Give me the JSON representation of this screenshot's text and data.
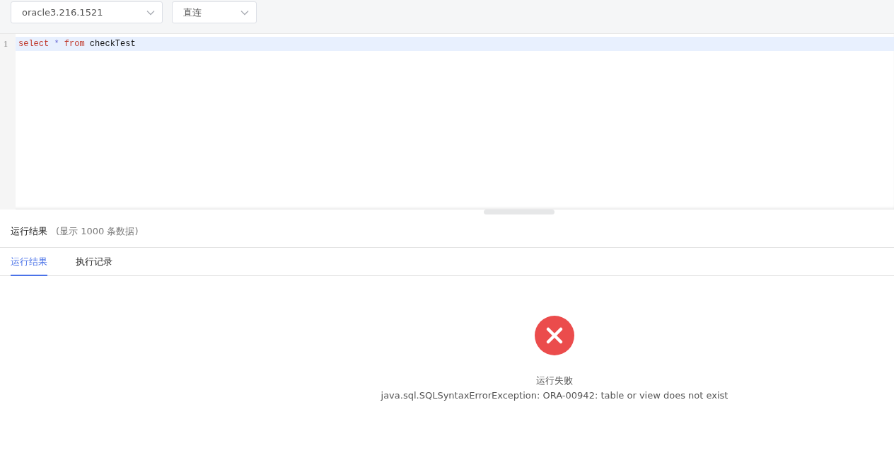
{
  "toolbar": {
    "selects": [
      {
        "value": "oracle3.216.1521"
      },
      {
        "value": "直连"
      }
    ]
  },
  "editor": {
    "lines": [
      {
        "number": "1",
        "active": true,
        "tokens": [
          {
            "kind": "keyword",
            "text": "select"
          },
          {
            "kind": "operator",
            "text": "*"
          },
          {
            "kind": "keyword",
            "text": "from"
          },
          {
            "kind": "identifier",
            "text": "checkTest"
          }
        ]
      }
    ]
  },
  "results": {
    "title": "运行结果",
    "subtitle": "(显示 1000 条数据)",
    "tabs": [
      {
        "label": "运行结果",
        "selected": true
      },
      {
        "label": "执行记录",
        "selected": false
      }
    ],
    "status": {
      "kind": "error",
      "title": "运行失败",
      "message": "java.sql.SQLSyntaxErrorException: ORA-00942: table or view does not exist"
    }
  }
}
